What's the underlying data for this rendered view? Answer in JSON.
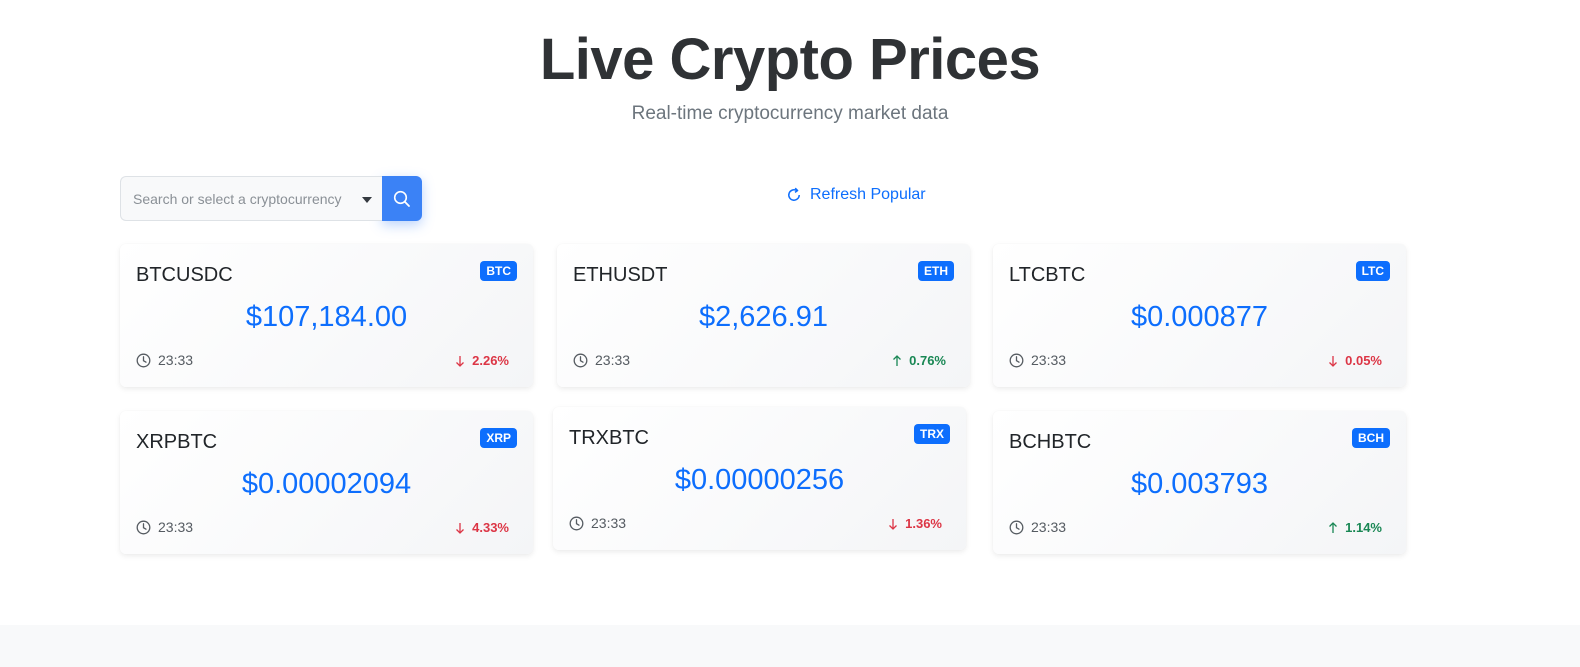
{
  "header": {
    "title": "Live Crypto Prices",
    "subtitle": "Real-time cryptocurrency market data"
  },
  "search": {
    "placeholder": "Search or select a cryptocurrency",
    "value": "",
    "button_icon": "search-icon",
    "dropdown_icon": "caret-down-icon"
  },
  "refresh": {
    "label": "Refresh Popular",
    "icon": "refresh-icon"
  },
  "colors": {
    "accent": "#0d6efd",
    "down": "#dc3545",
    "up": "#198754",
    "search_button": "#3b82f6"
  },
  "cards": [
    {
      "symbol": "BTCUSDC",
      "badge": "BTC",
      "price": "$107,184.00",
      "time": "23:33",
      "change": "2.26%",
      "direction": "down"
    },
    {
      "symbol": "ETHUSDT",
      "badge": "ETH",
      "price": "$2,626.91",
      "time": "23:33",
      "change": "0.76%",
      "direction": "up"
    },
    {
      "symbol": "LTCBTC",
      "badge": "LTC",
      "price": "$0.000877",
      "time": "23:33",
      "change": "0.05%",
      "direction": "down"
    },
    {
      "symbol": "XRPBTC",
      "badge": "XRP",
      "price": "$0.00002094",
      "time": "23:33",
      "change": "4.33%",
      "direction": "down"
    },
    {
      "symbol": "TRXBTC",
      "badge": "TRX",
      "price": "$0.00000256",
      "time": "23:33",
      "change": "1.36%",
      "direction": "down"
    },
    {
      "symbol": "BCHBTC",
      "badge": "BCH",
      "price": "$0.003793",
      "time": "23:33",
      "change": "1.14%",
      "direction": "up"
    }
  ]
}
